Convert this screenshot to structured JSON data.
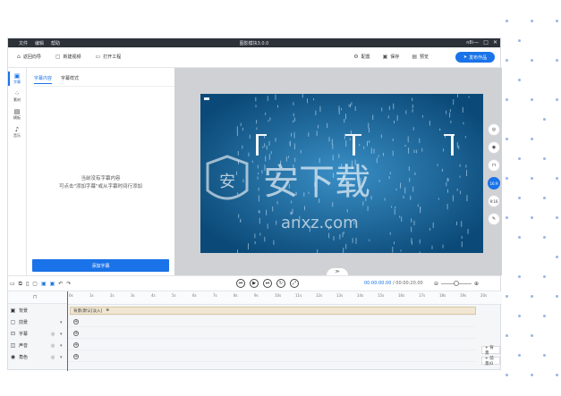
{
  "titlebar": {
    "menu": [
      "文件",
      "编辑",
      "帮助"
    ],
    "title": "图影模块3.0.0",
    "user": "n8i",
    "win": [
      "—",
      "□",
      "✕"
    ]
  },
  "toolbar": {
    "back": "返回向导",
    "new": "新建视频",
    "open": "打开工程",
    "settings": "配置",
    "save": "保存",
    "preview": "预览",
    "publish": "发布作品"
  },
  "nav": [
    {
      "label": "字幕",
      "icon": "caption-icon"
    },
    {
      "label": "素材",
      "icon": "material-icon"
    },
    {
      "label": "模板",
      "icon": "template-icon"
    },
    {
      "label": "音乐",
      "icon": "music-icon"
    }
  ],
  "panel": {
    "tabs": [
      "字幕内容",
      "字幕样式"
    ],
    "empty_line1": "当前没有字幕内容",
    "empty_line2": "可点击\"添加字幕\"或从字幕时间行添加",
    "add_button": "添加字幕"
  },
  "stage": {
    "ratio_label": "16:9",
    "ratio_alt": "9:16",
    "collapse": "≫"
  },
  "timeline": {
    "time_current": "00:00:00.00",
    "time_total": "/ 00:00:20.00",
    "ticks": [
      "0s",
      "1s",
      "2s",
      "3s",
      "4s",
      "5s",
      "6s",
      "7s",
      "8s",
      "9s",
      "10s",
      "11s",
      "12s",
      "13s",
      "14s",
      "15s",
      "16s",
      "17s",
      "18s",
      "19s",
      "20s"
    ],
    "tracks": [
      {
        "label": "背景",
        "icon": "background-icon"
      },
      {
        "label": "前景",
        "icon": "foreground-icon"
      },
      {
        "label": "字幕",
        "icon": "subtitle-icon"
      },
      {
        "label": "声音",
        "icon": "sound-icon"
      },
      {
        "label": "角色",
        "icon": "role-icon"
      }
    ],
    "bg_clip": "背景(默认[淡入]",
    "add_bg": "+ 背景",
    "add_fg": "+ 前景(0"
  }
}
